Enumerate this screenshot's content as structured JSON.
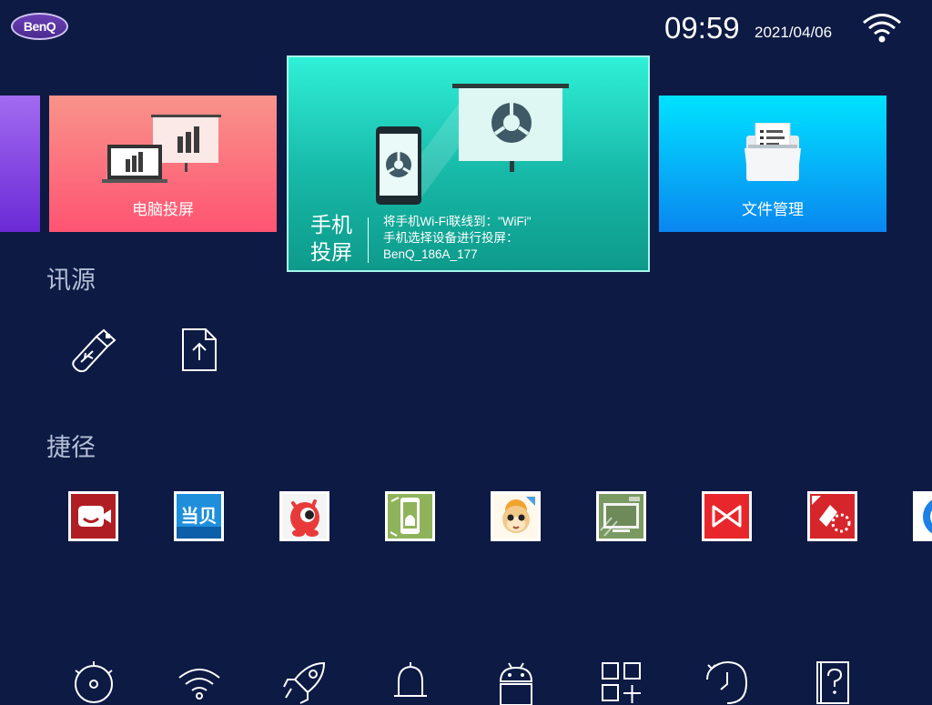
{
  "header": {
    "brand": "BenQ",
    "time": "09:59",
    "date": "2021/04/06"
  },
  "tiles": {
    "pc_cast": "电脑投屏",
    "mobile_cast_title_line1": "手机",
    "mobile_cast_title_line2": "投屏",
    "mobile_cast_info": [
      "将手机Wi-Fi联线到：\"WiFi\"",
      "手机选择设备进行投屏：",
      "BenQ_186A_177"
    ],
    "file_manager": "文件管理"
  },
  "sections": {
    "sources": "讯源",
    "shortcuts": "捷径"
  },
  "source_icons": [
    "usb-icon",
    "file-upload-icon"
  ],
  "shortcut_apps": [
    {
      "icon": "video-call-app-icon",
      "color": "#b01e23"
    },
    {
      "icon": "dangbei-app-icon",
      "color": "#1f8fdc",
      "label": "当贝"
    },
    {
      "icon": "red-monster-app-icon",
      "color": "#e93a3a"
    },
    {
      "icon": "apk-installer-app-icon",
      "color": "#8fb35a"
    },
    {
      "icon": "monkey-king-app-icon",
      "color": "#f0a430"
    },
    {
      "icon": "screen-mirror-pro-app-icon",
      "color": "#7a9a62"
    },
    {
      "icon": "wps-office-app-icon",
      "color": "#e8262b"
    },
    {
      "icon": "toolbox-app-icon",
      "color": "#d6252b"
    },
    {
      "icon": "partial-blue-app-icon",
      "color": "#1e7fe6"
    }
  ],
  "bottom_icons": [
    "settings-gear-icon",
    "wifi-icon",
    "rocket-icon",
    "notification-bell-icon",
    "android-icon",
    "all-apps-grid-icon",
    "history-clock-icon",
    "help-manual-icon"
  ],
  "colors": {
    "background": "#0c1a44",
    "pc_tile": "#ff5472",
    "mobile_tile": "#17b8a7",
    "files_tile": "#0a86f0",
    "prev_tile": "#6b2ad6"
  }
}
